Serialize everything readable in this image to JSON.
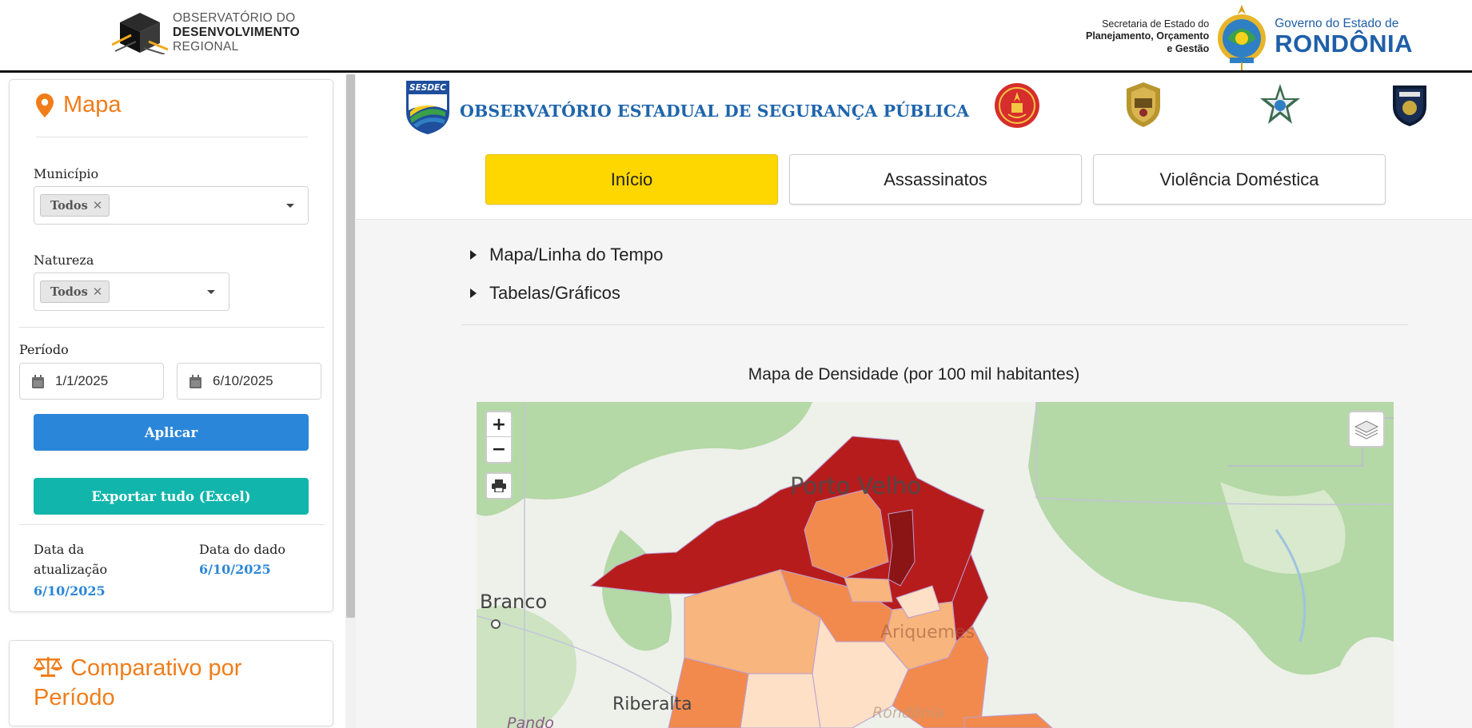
{
  "header": {
    "obs_logo": {
      "line1": "OBSERVATÓRIO DO",
      "line2": "DESENVOLVIMENTO",
      "line3": "REGIONAL"
    },
    "secretaria": {
      "line1": "Secretaria de Estado do",
      "line2": "Planejamento, Orçamento",
      "line3": "e Gestão"
    },
    "governo": {
      "line1": "Governo do Estado de",
      "line2": "RONDÔNIA"
    }
  },
  "sidebar": {
    "map_card": {
      "title": "Mapa",
      "municipio_label": "Município",
      "municipio_value": "Todos",
      "natureza_label": "Natureza",
      "natureza_value": "Todos",
      "periodo_label": "Período",
      "date_start": "1/1/2025",
      "date_end": "6/10/2025",
      "apply_label": "Aplicar",
      "export_label": "Exportar tudo (Excel)",
      "updated_label": "Data da atualização",
      "updated_value": "6/10/2025",
      "data_label": "Data do dado",
      "data_value": "6/10/2025"
    },
    "compare_card": {
      "title": "Comparativo por Período"
    }
  },
  "main": {
    "sesdec_label": "SESDEC",
    "title": "OBSERVATÓRIO ESTADUAL DE SEGURANÇA PÚBLICA",
    "tabs": [
      {
        "label": "Início",
        "active": true
      },
      {
        "label": "Assassinatos",
        "active": false
      },
      {
        "label": "Violência Doméstica",
        "active": false
      }
    ],
    "accordion": [
      {
        "label": "Mapa/Linha do Tempo"
      },
      {
        "label": "Tabelas/Gráficos"
      }
    ],
    "map_title": "Mapa de Densidade (por 100 mil habitantes)",
    "map": {
      "zoom_in": "+",
      "zoom_out": "−",
      "places": {
        "porto_velho": "Porto Velho",
        "branco": "Branco",
        "riberalta": "Riberalta",
        "ariquemes": "Ariquemes",
        "pando": "Pando",
        "rondonia": "Rondônia"
      }
    }
  },
  "colors": {
    "accent_orange": "#f07d1a",
    "primary_blue": "#2a86d8",
    "teal": "#12b5ab",
    "tab_active": "#ffd700",
    "density_high": "#b71c1c",
    "density_mid": "#f28a4e",
    "density_low": "#fde0c5"
  },
  "icons": {
    "map_pin": "map-pin-icon",
    "scale": "scale-balance-icon",
    "calendar": "calendar-icon",
    "print": "print-icon",
    "layers": "layers-icon"
  }
}
